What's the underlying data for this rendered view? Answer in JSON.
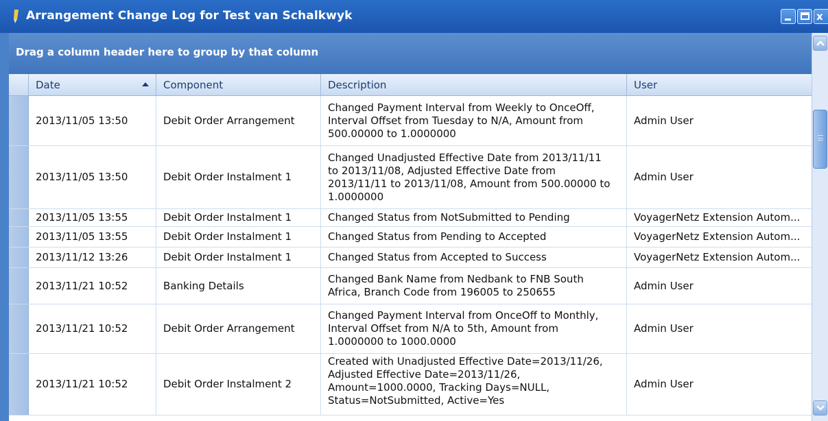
{
  "window": {
    "title": "Arrangement Change Log for Test van Schalkwyk",
    "icon": "pencil-icon",
    "close_glyph": "x"
  },
  "grid": {
    "group_panel_text": "Drag a column header here to group by that column",
    "columns": {
      "date": "Date",
      "component": "Component",
      "description": "Description",
      "user": "User"
    },
    "sort": {
      "column": "date",
      "direction": "ascending"
    },
    "rows": [
      {
        "date": "2013/11/05 13:50",
        "component": "Debit Order Arrangement",
        "description": "Changed Payment Interval from Weekly to OnceOff,\nInterval Offset from Tuesday to N/A, Amount from\n500.00000 to 1.0000000",
        "user": "Admin User"
      },
      {
        "date": "2013/11/05 13:50",
        "component": "Debit Order Instalment 1",
        "description": "Changed Unadjusted Effective Date from 2013/11/11\nto 2013/11/08, Adjusted Effective Date from\n2013/11/11 to 2013/11/08, Amount from 500.00000 to\n1.0000000",
        "user": "Admin User"
      },
      {
        "date": "2013/11/05 13:55",
        "component": "Debit Order Instalment 1",
        "description": "Changed Status from NotSubmitted to Pending",
        "user": "VoyagerNetz Extension Autom..."
      },
      {
        "date": "2013/11/05 13:55",
        "component": "Debit Order Instalment 1",
        "description": "Changed Status from Pending to Accepted",
        "user": "VoyagerNetz Extension Autom..."
      },
      {
        "date": "2013/11/12 13:26",
        "component": "Debit Order Instalment 1",
        "description": "Changed Status from Accepted to Success",
        "user": "VoyagerNetz Extension Autom..."
      },
      {
        "date": "2013/11/21 10:52",
        "component": "Banking Details",
        "description": "Changed Bank Name from Nedbank to FNB South\nAfrica, Branch Code from 196005 to 250655",
        "user": "Admin User"
      },
      {
        "date": "2013/11/21 10:52",
        "component": "Debit Order Arrangement",
        "description": "Changed Payment Interval from OnceOff to Monthly,\nInterval Offset from N/A to 5th, Amount from\n1.0000000 to 1000.0000",
        "user": "Admin User"
      },
      {
        "date": "2013/11/21 10:52",
        "component": "Debit Order Instalment 2",
        "description": "Created with Unadjusted Effective Date=2013/11/26,\nAdjusted Effective Date=2013/11/26,\nAmount=1000.0000, Tracking Days=NULL,\nStatus=NotSubmitted, Active=Yes",
        "user": "Admin User"
      }
    ]
  },
  "colors": {
    "titlebar": "#1f5fbf",
    "group_panel": "#4a7fc6",
    "header": "#d6e4f5",
    "row_indicator": "#aec7e8"
  }
}
